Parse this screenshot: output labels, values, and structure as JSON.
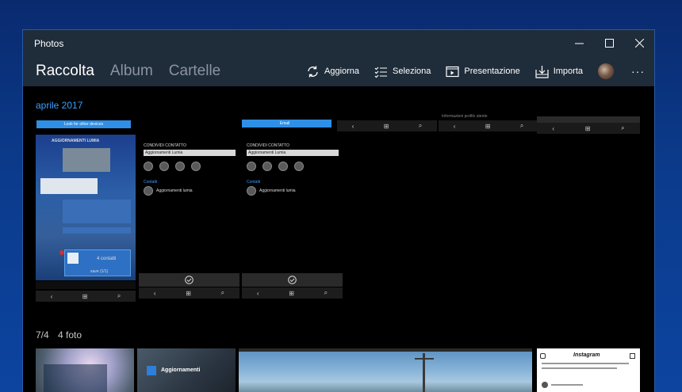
{
  "window": {
    "title": "Photos",
    "minimize_icon": "minimize-icon",
    "maximize_icon": "maximize-icon",
    "close_icon": "close-icon"
  },
  "nav": {
    "tabs": [
      {
        "label": "Raccolta",
        "active": true
      },
      {
        "label": "Album",
        "active": false
      },
      {
        "label": "Cartelle",
        "active": false
      }
    ]
  },
  "toolbar": {
    "refresh_label": "Aggiorna",
    "select_label": "Seleziona",
    "slideshow_label": "Presentazione",
    "import_label": "Importa",
    "more_label": "···"
  },
  "groups": [
    {
      "title": "aprile 2017"
    },
    {
      "date": "7/4",
      "count": "4 foto"
    }
  ],
  "screens": {
    "t1_button": "Look for other devices",
    "t1_header": "AGGIORNAMENTI LUMIA",
    "t1_contacts": "4 contatti",
    "t1_save": "save (1/1)",
    "t2_title": "CONDIVIDI CONTATTO",
    "t2_field": "Aggiornamenti Lumia",
    "t2_section": "Contatti",
    "t2_contact": "Aggiornamenti lumia",
    "t3_button": "Email",
    "t3_title": "CONDIVIDI CONTATTO",
    "t3_field": "Aggiornamenti Lumia",
    "t3_section": "Contatti",
    "t3_contact": "Aggiornamenti lumia",
    "t5_caption": "Informazioni profilo utente",
    "b2_label": "Aggiornamenti",
    "b4_title": "Instagram"
  },
  "colors": {
    "accent": "#3aa0ff",
    "titlebar": "#1f2c3a",
    "desktop": "#0b3a8a"
  }
}
